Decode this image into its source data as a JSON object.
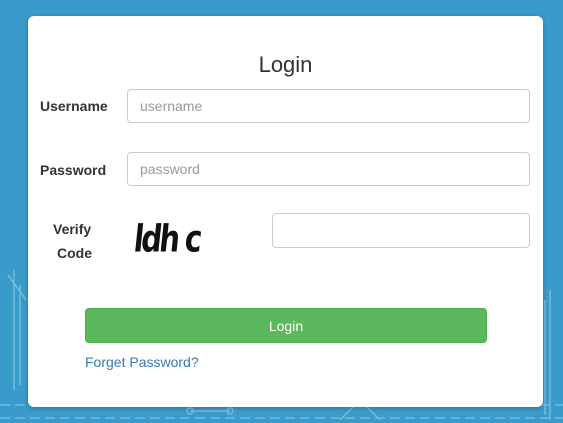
{
  "form": {
    "title": "Login",
    "username_label": "Username",
    "username_placeholder": "username",
    "username_value": "",
    "password_label": "Password",
    "password_placeholder": "password",
    "password_value": "",
    "verify_label_line1": "Verify",
    "verify_label_line2": "Code",
    "captcha_text": "ldh c",
    "verify_value": "",
    "login_button_label": "Login",
    "forget_link": "Forget Password?"
  },
  "colors": {
    "background": "#3a9ac9",
    "login_button": "#5cb85c",
    "link": "#337ab7"
  }
}
